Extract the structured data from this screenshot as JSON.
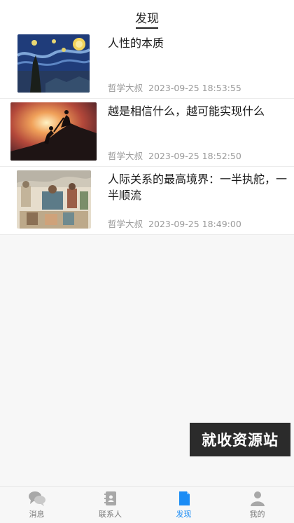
{
  "header": {
    "title": "发现"
  },
  "feed": [
    {
      "title": "人性的本质",
      "author": "哲学大叔",
      "time": "2023-09-25 18:53:55"
    },
    {
      "title": "越是相信什么，越可能实现什么",
      "author": "哲学大叔",
      "time": "2023-09-25 18:52:50"
    },
    {
      "title": "人际关系的最高境界：一半执舵，一半顺流",
      "author": "哲学大叔",
      "time": "2023-09-25 18:49:00"
    }
  ],
  "watermark": "就收资源站",
  "tabs": [
    {
      "label": "消息",
      "icon": "chat-bubbles-icon"
    },
    {
      "label": "联系人",
      "icon": "contacts-book-icon"
    },
    {
      "label": "发现",
      "icon": "document-icon",
      "active": true
    },
    {
      "label": "我的",
      "icon": "person-icon"
    }
  ],
  "colors": {
    "accent": "#1b8cf5",
    "muted": "#9a9a9a",
    "watermark_bg": "#2b2b2b"
  }
}
